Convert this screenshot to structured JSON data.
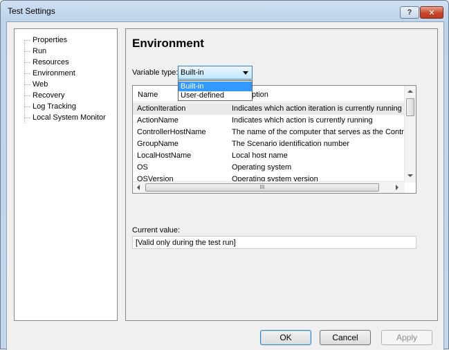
{
  "window": {
    "title": "Test Settings",
    "help_label": "?",
    "close_label": "✕"
  },
  "tree": {
    "items": [
      {
        "label": "Properties"
      },
      {
        "label": "Run"
      },
      {
        "label": "Resources"
      },
      {
        "label": "Environment",
        "selected": true
      },
      {
        "label": "Web"
      },
      {
        "label": "Recovery"
      },
      {
        "label": "Log Tracking"
      },
      {
        "label": "Local System Monitor"
      }
    ]
  },
  "panel": {
    "heading": "Environment",
    "variable_type_label": "Variable type:",
    "variable_type_value": "Built-in",
    "dropdown_options": [
      "Built-in",
      "User-defined"
    ],
    "columns": {
      "name": "Name",
      "description": "ption"
    },
    "rows": [
      {
        "name": "ActionIteration",
        "description": "Indicates which action iteration is currently running"
      },
      {
        "name": "ActionName",
        "description": "Indicates which action is currently running"
      },
      {
        "name": "ControllerHostName",
        "description": "The name of the computer that serves as the Control"
      },
      {
        "name": "GroupName",
        "description": "The Scenario identification number"
      },
      {
        "name": "LocalHostName",
        "description": "Local host name"
      },
      {
        "name": "OS",
        "description": "Operating system"
      },
      {
        "name": "OSVersion",
        "description": "Operating system version"
      }
    ],
    "hscroll_grip": "III",
    "current_value_label": "Current value:",
    "current_value": "[Valid only during the test run]"
  },
  "buttons": {
    "ok": "OK",
    "cancel": "Cancel",
    "apply": "Apply"
  }
}
